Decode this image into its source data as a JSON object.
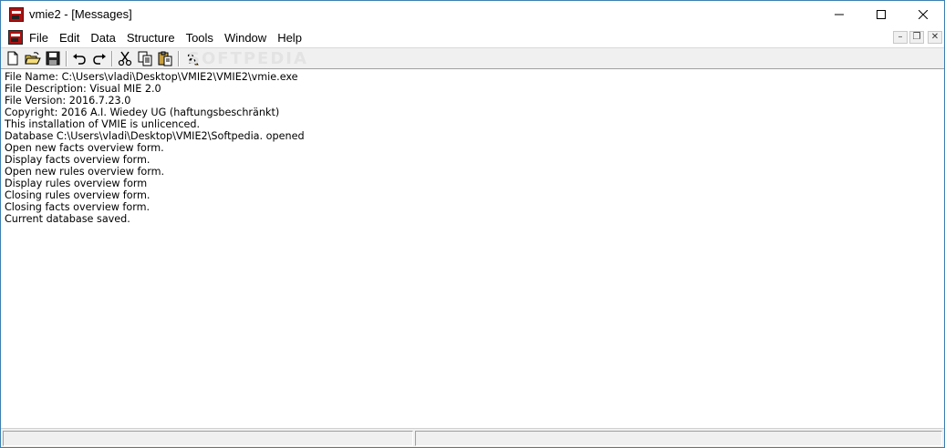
{
  "window": {
    "title": "vmie2 - [Messages]",
    "app_icon": "vmie-app-icon"
  },
  "menu": {
    "items": [
      "File",
      "Edit",
      "Data",
      "Structure",
      "Tools",
      "Window",
      "Help"
    ]
  },
  "mdi_controls": {
    "minimize": "–",
    "restore": "❐",
    "close": "✕"
  },
  "toolbar": {
    "buttons": [
      "new-icon",
      "open-icon",
      "save-icon",
      "undo-icon",
      "redo-icon",
      "cut-icon",
      "copy-icon",
      "paste-icon",
      "help-icon"
    ]
  },
  "watermark": "SOFTPEDIA",
  "messages": [
    "File Name: C:\\Users\\vladi\\Desktop\\VMIE2\\VMIE2\\vmie.exe",
    "File Description: Visual MIE 2.0",
    "File Version: 2016.7.23.0",
    "Copyright: 2016 A.I. Wiedey UG (haftungsbeschränkt)",
    "This installation of VMIE is unlicenced.",
    "Database C:\\Users\\vladi\\Desktop\\VMIE2\\Softpedia. opened",
    "Open new facts overview form.",
    "Display facts overview form.",
    "Open new rules overview form.",
    "Display rules overview form",
    "Closing rules overview form.",
    "Closing facts overview form.",
    "Current database saved."
  ],
  "status": {
    "pane1": "",
    "pane2": ""
  }
}
